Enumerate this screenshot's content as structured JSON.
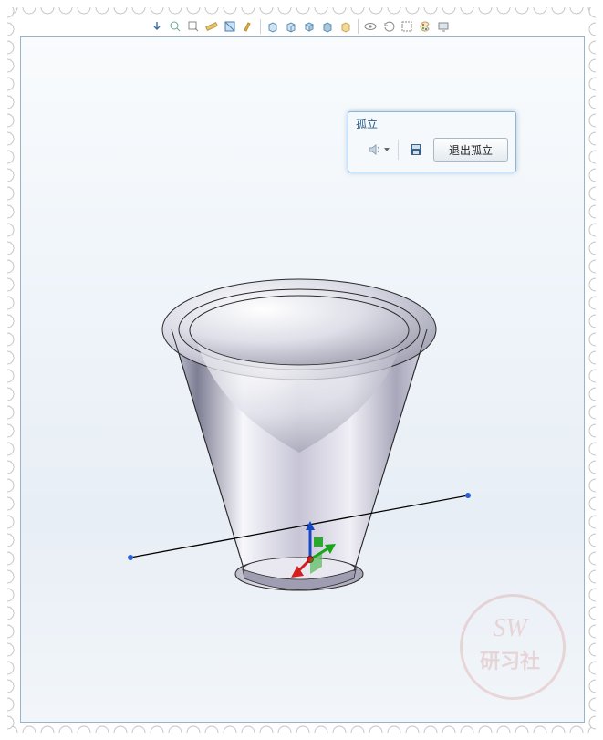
{
  "toolbar": {
    "icons": [
      "arrow-down-icon",
      "zoom-fit-icon",
      "zoom-area-icon",
      "ruler-icon",
      "section-icon",
      "chisel-icon",
      "cube-front-icon",
      "cube-dd-icon",
      "cube-iso-icon",
      "cube-shade-icon",
      "cube-color-icon",
      "eye-icon",
      "refresh-icon",
      "select-icon",
      "palette-icon",
      "monitor-icon"
    ]
  },
  "panel": {
    "title": "孤立",
    "speaker_button": "speaker",
    "save_button": "save",
    "exit_label": "退出孤立"
  },
  "watermark": {
    "line1": "SW",
    "line2": "研习社"
  },
  "scene": {
    "triad_axes": {
      "x": "red",
      "y": "green",
      "z": "blue"
    },
    "construction_line": true
  }
}
